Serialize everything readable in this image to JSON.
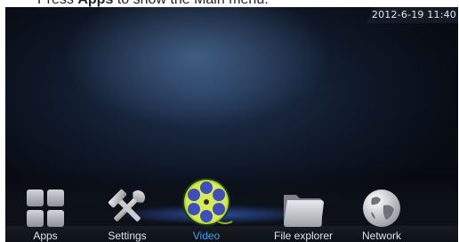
{
  "caption": {
    "prefix": "Press ",
    "bold": "Apps",
    "suffix": " to show the Main menu."
  },
  "status_bar": {
    "datetime": "2012-6-19 11:40"
  },
  "dock": {
    "items": [
      {
        "label": "Apps",
        "icon": "apps-grid-icon",
        "selected": false
      },
      {
        "label": "Settings",
        "icon": "tools-icon",
        "selected": false
      },
      {
        "label": "Video",
        "icon": "film-reel-icon",
        "selected": true
      },
      {
        "label": "File explorer",
        "icon": "folder-icon",
        "selected": false
      },
      {
        "label": "Network",
        "icon": "globe-icon",
        "selected": false
      }
    ]
  },
  "colors": {
    "selected_label": "#3fa0ff",
    "label": "#dfe3ea",
    "background": "#0f1828"
  }
}
